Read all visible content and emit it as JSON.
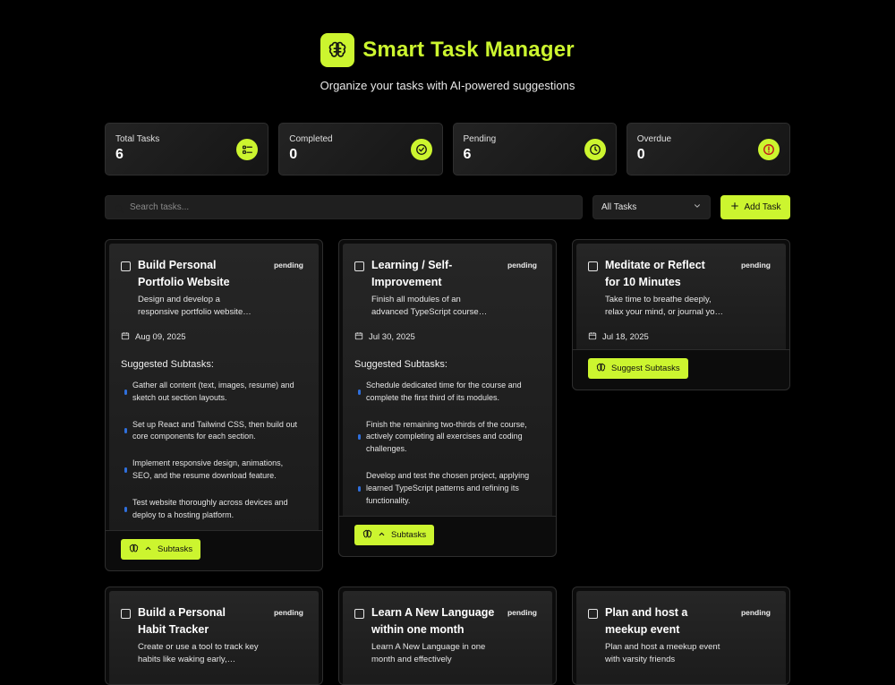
{
  "app": {
    "title": "Smart Task Manager",
    "subtitle": "Organize your tasks with AI-powered suggestions",
    "accent": "#ccf52f"
  },
  "stats": [
    {
      "label": "Total Tasks",
      "value": "6",
      "icon": "list-icon"
    },
    {
      "label": "Completed",
      "value": "0",
      "icon": "check-circle-icon"
    },
    {
      "label": "Pending",
      "value": "6",
      "icon": "clock-icon"
    },
    {
      "label": "Overdue",
      "value": "0",
      "icon": "alert-circle-icon"
    }
  ],
  "toolbar": {
    "search_placeholder": "Search tasks...",
    "filter_value": "All Tasks",
    "add_label": "Add Task"
  },
  "cards": [
    {
      "title": "Build Personal Portfolio Website",
      "status": "pending",
      "description": "Design and develop a responsive portfolio website…",
      "date": "Aug 09, 2025",
      "suggested_title": "Suggested Subtasks:",
      "subtasks": [
        "Gather all content (text, images, resume) and sketch out section layouts.",
        "Set up React and Tailwind CSS, then build out core components for each section.",
        "Implement responsive design, animations, SEO, and the resume download feature.",
        "Test website thoroughly across devices and deploy to a hosting platform."
      ],
      "button": "Subtasks"
    },
    {
      "title": "Learning / Self-Improvement",
      "status": "pending",
      "description": "Finish all modules of an advanced TypeScript course…",
      "date": "Jul 30, 2025",
      "suggested_title": "Suggested Subtasks:",
      "subtasks": [
        "Schedule dedicated time for the course and complete the first third of its modules.",
        "Finish the remaining two-thirds of the course, actively completing all exercises and coding challenges.",
        "Develop and test the chosen project, applying learned TypeScript patterns and refining its functionality."
      ],
      "button": "Subtasks"
    },
    {
      "title": "Meditate or Reflect for 10 Minutes",
      "status": "pending",
      "description": "Take time to breathe deeply, relax your mind, or journal yo…",
      "date": "Jul 18, 2025",
      "button": "Suggest Subtasks"
    },
    {
      "title": "Build a Personal Habit Tracker",
      "status": "pending",
      "description": "Create or use a tool to track key habits like waking early,…"
    },
    {
      "title": "Learn A New Language within one month",
      "status": "pending",
      "description": "Learn A New Language in one month and effectively"
    },
    {
      "title": "Plan and host a meekup event",
      "status": "pending",
      "description": "Plan and host a meekup event with varsity friends"
    }
  ]
}
